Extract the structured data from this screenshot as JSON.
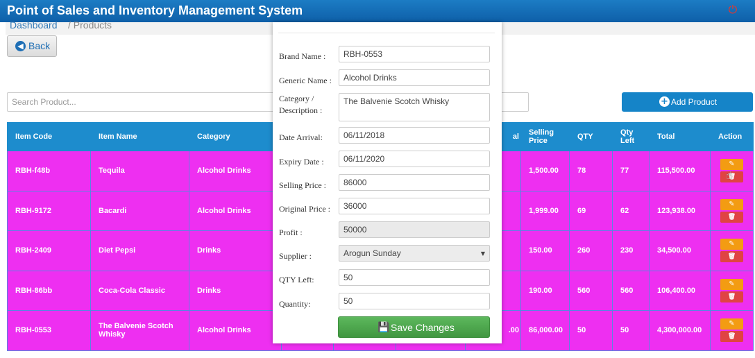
{
  "app": {
    "title": "Point of Sales and Inventory Management System"
  },
  "header": {
    "power_icon": "power-icon"
  },
  "breadcrumb": {
    "home": "Dashboard",
    "separator": "/ Products"
  },
  "back_button": {
    "label": "Back",
    "icon": "arrow-left-circle-icon"
  },
  "search": {
    "placeholder": "Search Product...",
    "value": ""
  },
  "add_button": {
    "label": "Add Product",
    "icon": "plus-circle-icon"
  },
  "table": {
    "headers": [
      "Item Code",
      "Item Name",
      "Category",
      "",
      "",
      "",
      "al",
      "Selling Price",
      "QTY",
      "Qty Left",
      "Total",
      "Action"
    ],
    "rows": [
      {
        "code": "RBH-f48b",
        "name": "Tequila",
        "category": "Alcohol Drinks",
        "orig": "",
        "selling": "1,500.00",
        "qty": "78",
        "qty_left": "77",
        "total": "115,500.00"
      },
      {
        "code": "RBH-9172",
        "name": "Bacardi",
        "category": "Alcohol Drinks",
        "orig": "",
        "selling": "1,999.00",
        "qty": "69",
        "qty_left": "62",
        "total": "123,938.00"
      },
      {
        "code": "RBH-2409",
        "name": "Diet Pepsi",
        "category": "Drinks",
        "orig": "",
        "selling": "150.00",
        "qty": "260",
        "qty_left": "230",
        "total": "34,500.00"
      },
      {
        "code": "RBH-86bb",
        "name": "Coca-Cola Classic",
        "category": "Drinks",
        "orig": "",
        "selling": "190.00",
        "qty": "560",
        "qty_left": "560",
        "total": "106,400.00"
      },
      {
        "code": "RBH-0553",
        "name": "The Balvenie Scotch Whisky",
        "category": "Alcohol Drinks",
        "orig": ".00",
        "selling": "86,000.00",
        "qty": "50",
        "qty_left": "50",
        "total": "4,300,000.00"
      }
    ]
  },
  "colors": {
    "header_bg": "#1d8ccd",
    "row_bg": "#ee2ff1",
    "topbar": "#0e5fa8",
    "save": "#5cb85c",
    "edit": "#f39c12",
    "delete": "#e04343"
  },
  "modal": {
    "fields": {
      "brand_name": {
        "label": "Brand Name :",
        "value": "RBH-0553"
      },
      "generic_name": {
        "label": "Generic Name :",
        "value": "Alcohol Drinks"
      },
      "category_l1": "Category /",
      "category_l2": "Description :",
      "category_value": "The Balvenie Scotch Whisky",
      "date_arrival": {
        "label": "Date Arrival:",
        "value": "06/11/2018"
      },
      "expiry_date": {
        "label": "Expiry Date :",
        "value": "06/11/2020"
      },
      "selling_price": {
        "label": "Selling Price :",
        "value": "86000"
      },
      "original_price": {
        "label": "Original Price :",
        "value": "36000"
      },
      "profit": {
        "label": "Profit :",
        "value": "50000"
      },
      "supplier": {
        "label": "Supplier :",
        "value": "Arogun Sunday"
      },
      "qty_left": {
        "label": "QTY Left:",
        "value": "50"
      },
      "quantity": {
        "label": "Quantity:",
        "value": "50"
      }
    },
    "save_label": "Save Changes",
    "save_icon": "floppy-disk-icon"
  }
}
